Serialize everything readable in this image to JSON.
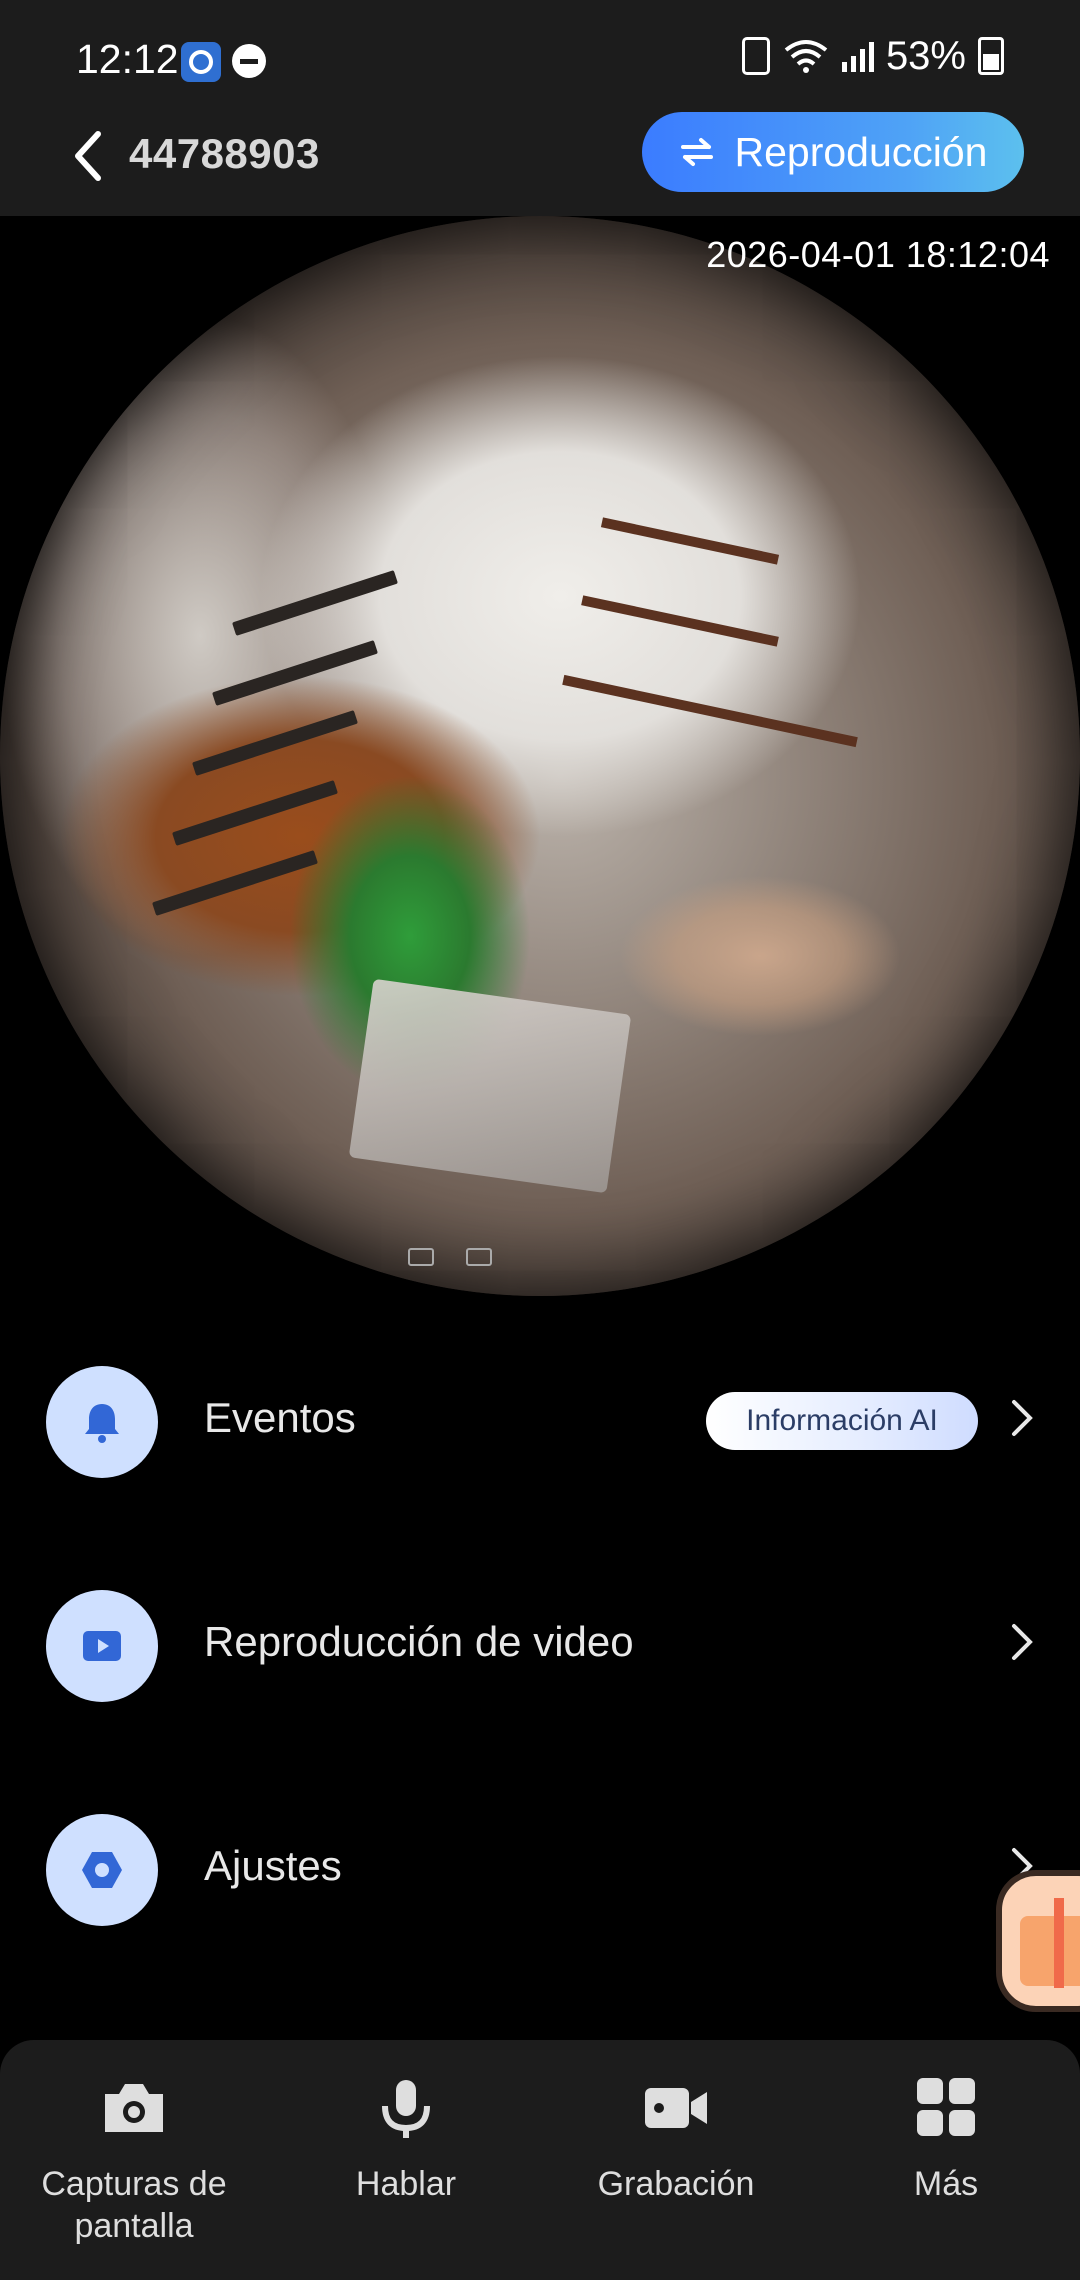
{
  "status_bar": {
    "time": "12:12",
    "battery_percent": "53%"
  },
  "header": {
    "device_id": "44788903",
    "playback_button": "Reproducción"
  },
  "video": {
    "timestamp": "2026-04-01 18:12:04"
  },
  "menu": {
    "events": {
      "label": "Eventos",
      "badge": "Información AI"
    },
    "video_playback": {
      "label": "Reproducción de video"
    },
    "settings": {
      "label": "Ajustes"
    }
  },
  "bottom_tabs": [
    {
      "label": "Capturas de pantalla",
      "icon": "camera-icon"
    },
    {
      "label": "Hablar",
      "icon": "microphone-icon"
    },
    {
      "label": "Grabación",
      "icon": "video-camera-icon"
    },
    {
      "label": "Más",
      "icon": "grid-icon"
    }
  ],
  "colors": {
    "accent": "#3b7cff",
    "icon_circle": "#cfe0ff",
    "icon_fill": "#3267d6",
    "bar_background": "#1c1c1c"
  }
}
